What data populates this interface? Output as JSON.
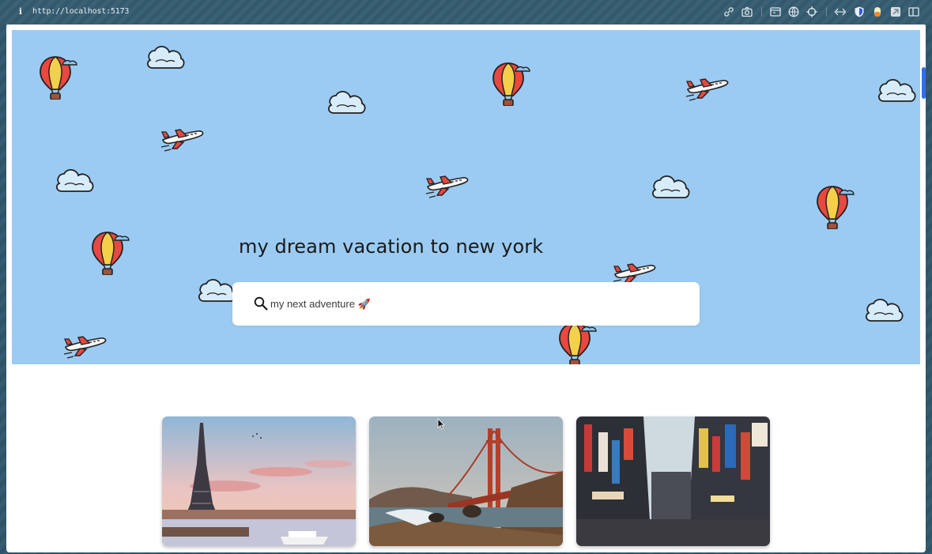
{
  "browser": {
    "url": "http://localhost:5173",
    "icons": [
      "info-icon",
      "link-icon",
      "camera-icon",
      "screen-icon",
      "globe-icon",
      "crosshair-icon",
      "code-icon",
      "shield-icon",
      "extension-icon",
      "bookmark-icon",
      "sidebar-icon"
    ]
  },
  "hero": {
    "background_color": "#9bcbf2",
    "headline": "my dream vacation to new york",
    "decorations": [
      "hot-air-balloon-icon",
      "cloud-icon",
      "airplane-icon"
    ]
  },
  "search": {
    "placeholder": "my next adventure 🚀",
    "value": ""
  },
  "destinations": [
    {
      "name": "paris-eiffel-tower-card"
    },
    {
      "name": "san-francisco-golden-gate-card"
    },
    {
      "name": "tokyo-street-card"
    }
  ]
}
